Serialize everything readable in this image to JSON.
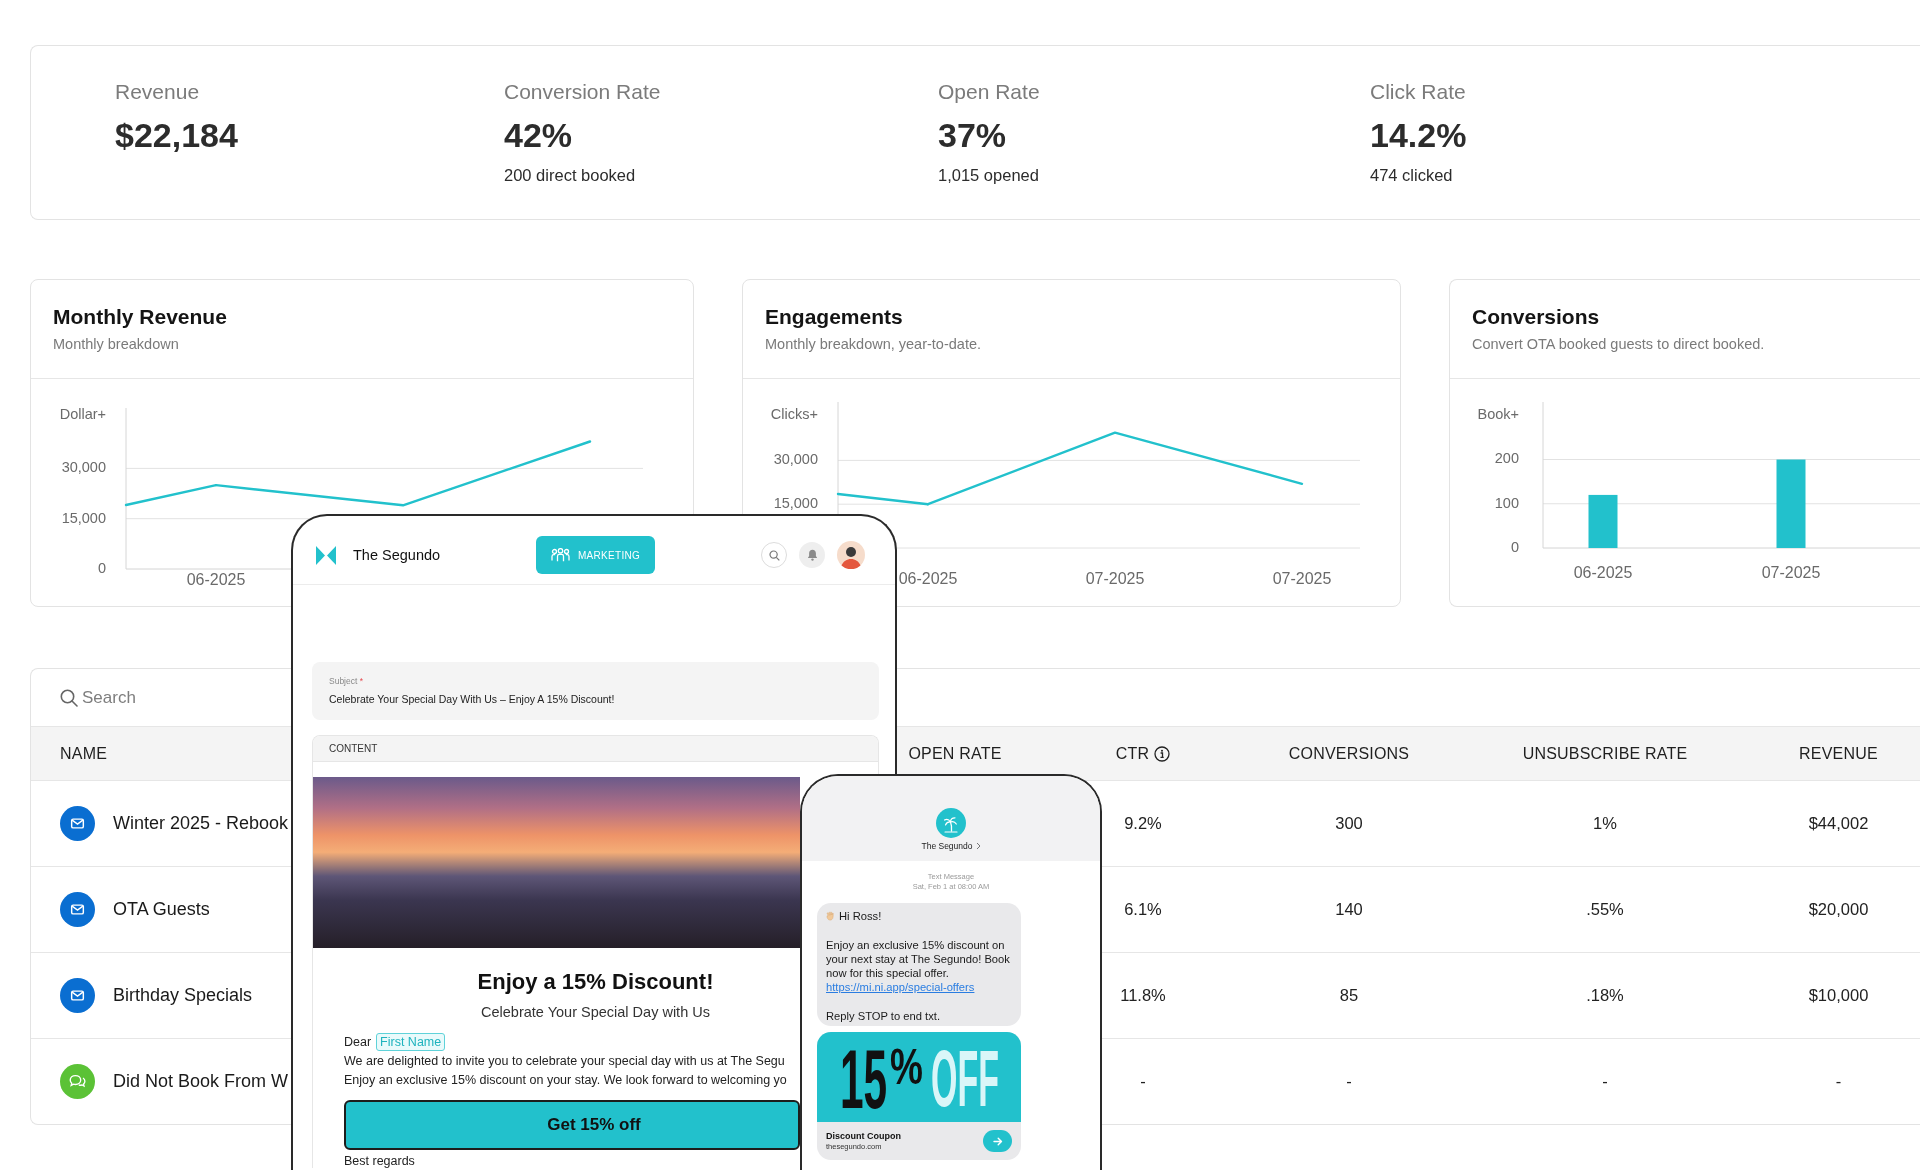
{
  "stats": [
    {
      "label": "Revenue",
      "value": "$22,184"
    },
    {
      "label": "Conversion Rate",
      "value": "42%",
      "detail": "200 direct booked"
    },
    {
      "label": "Open Rate",
      "value": "37%",
      "detail": "1,015 opened"
    },
    {
      "label": "Click Rate",
      "value": "14.2%",
      "detail": "474 clicked"
    }
  ],
  "charts": [
    {
      "title": "Monthly Revenue",
      "subtitle": "Monthly breakdown",
      "chart_data": {
        "type": "line",
        "ylabel": "Dollar+",
        "categories": [
          "06-2025",
          null,
          null
        ],
        "values": [
          25000,
          19000,
          38000
        ],
        "ylim": [
          0,
          48000
        ],
        "yticks": [
          {
            "value": 0,
            "label": "0"
          },
          {
            "value": 15000,
            "label": "15,000"
          },
          {
            "value": 30000,
            "label": "30,000"
          }
        ]
      }
    },
    {
      "title": "Engagements",
      "subtitle": "Monthly breakdown, year-to-date.",
      "chart_data": {
        "type": "line",
        "ylabel": "Clicks+",
        "categories": [
          "06-2025",
          "07-2025",
          "07-2025"
        ],
        "values": [
          15000,
          39500,
          22000
        ],
        "ylim": [
          0,
          50000
        ],
        "yticks": [
          {
            "value": 15000,
            "label": "15,000"
          },
          {
            "value": 30000,
            "label": "30,000"
          }
        ]
      }
    },
    {
      "title": "Conversions",
      "subtitle": "Convert OTA booked guests to direct booked.",
      "chart_data": {
        "type": "bar",
        "ylabel": "Book+",
        "categories": [
          "06-2025",
          "07-2025"
        ],
        "values": [
          120,
          200
        ],
        "ylim": [
          0,
          330
        ],
        "yticks": [
          0,
          100,
          200
        ]
      }
    }
  ],
  "table": {
    "search": {
      "placeholder": "Search"
    },
    "columns": [
      {
        "label": "NAME",
        "info": false
      },
      {
        "label": "OPEN RATE",
        "info": false
      },
      {
        "label": "CTR",
        "info": true
      },
      {
        "label": "CONVERSIONS",
        "info": false
      },
      {
        "label": "UNSUBSCRIBE RATE",
        "info": false
      },
      {
        "label": "REVENUE",
        "info": false
      }
    ],
    "rows": [
      {
        "kind": "email",
        "name": "Winter 2025 - Rebook",
        "ctr": "9.2%",
        "conversions": "300",
        "unsubscribe_rate": "1%",
        "revenue": "$44,002"
      },
      {
        "kind": "email",
        "name": "OTA Guests",
        "ctr": "6.1%",
        "conversions": "140",
        "unsubscribe_rate": ".55%",
        "revenue": "$20,000"
      },
      {
        "kind": "email",
        "name": "Birthday Specials",
        "ctr": "11.8%",
        "conversions": "85",
        "unsubscribe_rate": ".18%",
        "revenue": "$10,000"
      },
      {
        "kind": "sms",
        "name": "Did Not Book From W",
        "ctr": "-",
        "conversions": "-",
        "unsubscribe_rate": "-",
        "revenue": "-"
      }
    ]
  },
  "email_editor": {
    "brand": "The Segundo",
    "section_button": "MARKETING",
    "subject": {
      "label": "Subject",
      "required_mark": "*",
      "value": "Celebrate Your Special Day With Us – Enjoy A 15% Discount!"
    },
    "content": {
      "label": "CONTENT",
      "headline": "Enjoy a 15% Discount!",
      "subheadline": "Celebrate Your Special Day with Us",
      "salutation": "Dear",
      "merge_tag": "First Name",
      "body_lines": [
        "We are delighted to invite you to celebrate your special day with us at The Segu",
        "Enjoy an exclusive 15% discount on your stay. We look forward to welcoming yo"
      ],
      "button": "Get 15% off",
      "closing": "Best regards"
    }
  },
  "sms_preview": {
    "sender": "The Segundo",
    "meta": "Text Message",
    "timestamp": "Sat, Feb 1 at 08:00 AM",
    "message": {
      "greeting": "Hi Ross!",
      "body": "Enjoy an exclusive 15% discount on your next stay at The Segundo! Book now for this special offer.",
      "link": "https://mi.ni.app/special-offers",
      "footer": "Reply STOP to end txt."
    },
    "coupon": {
      "number": "15",
      "unit": "%",
      "word": "OFF",
      "title": "Discount Coupon",
      "domain": "thesegundo.com"
    }
  }
}
